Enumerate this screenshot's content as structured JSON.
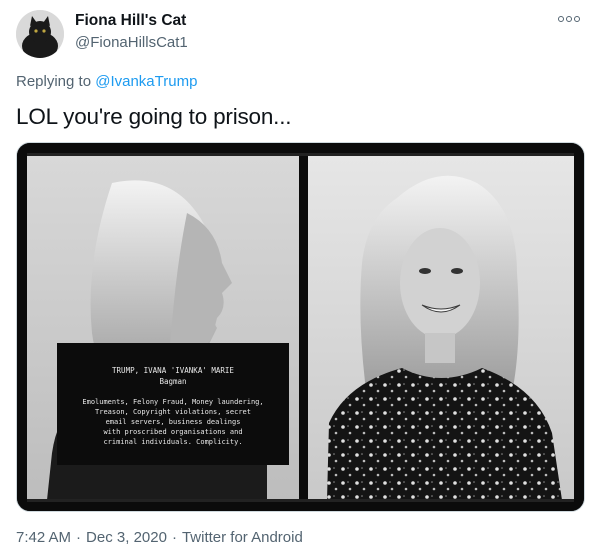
{
  "author": {
    "display_name": "Fiona Hill's Cat",
    "handle": "@FionaHillsCat1",
    "avatar_icon": "cat-avatar"
  },
  "more_icon": "more-options-icon",
  "reply": {
    "prefix": "Replying to ",
    "mention": "@IvankaTrump"
  },
  "tweet": {
    "text": "LOL you're going to prison..."
  },
  "media": {
    "placard": {
      "line1": "TRUMP, IVANA 'IVANKA' MARIE",
      "line2": "Bagman",
      "line3": "Emoluments, Felony Fraud, Money laundering,",
      "line4": "Treason, Copyright violations, secret",
      "line5": "email servers, business dealings",
      "line6": "with proscribed organisations and",
      "line7": "criminal individuals. Complicity."
    }
  },
  "meta": {
    "time": "7:42 AM",
    "date": "Dec 3, 2020",
    "source": "Twitter for Android",
    "separator": "·"
  },
  "colors": {
    "link": "#1d9bf0",
    "secondary_text": "#536471",
    "primary_text": "#0f1419"
  }
}
